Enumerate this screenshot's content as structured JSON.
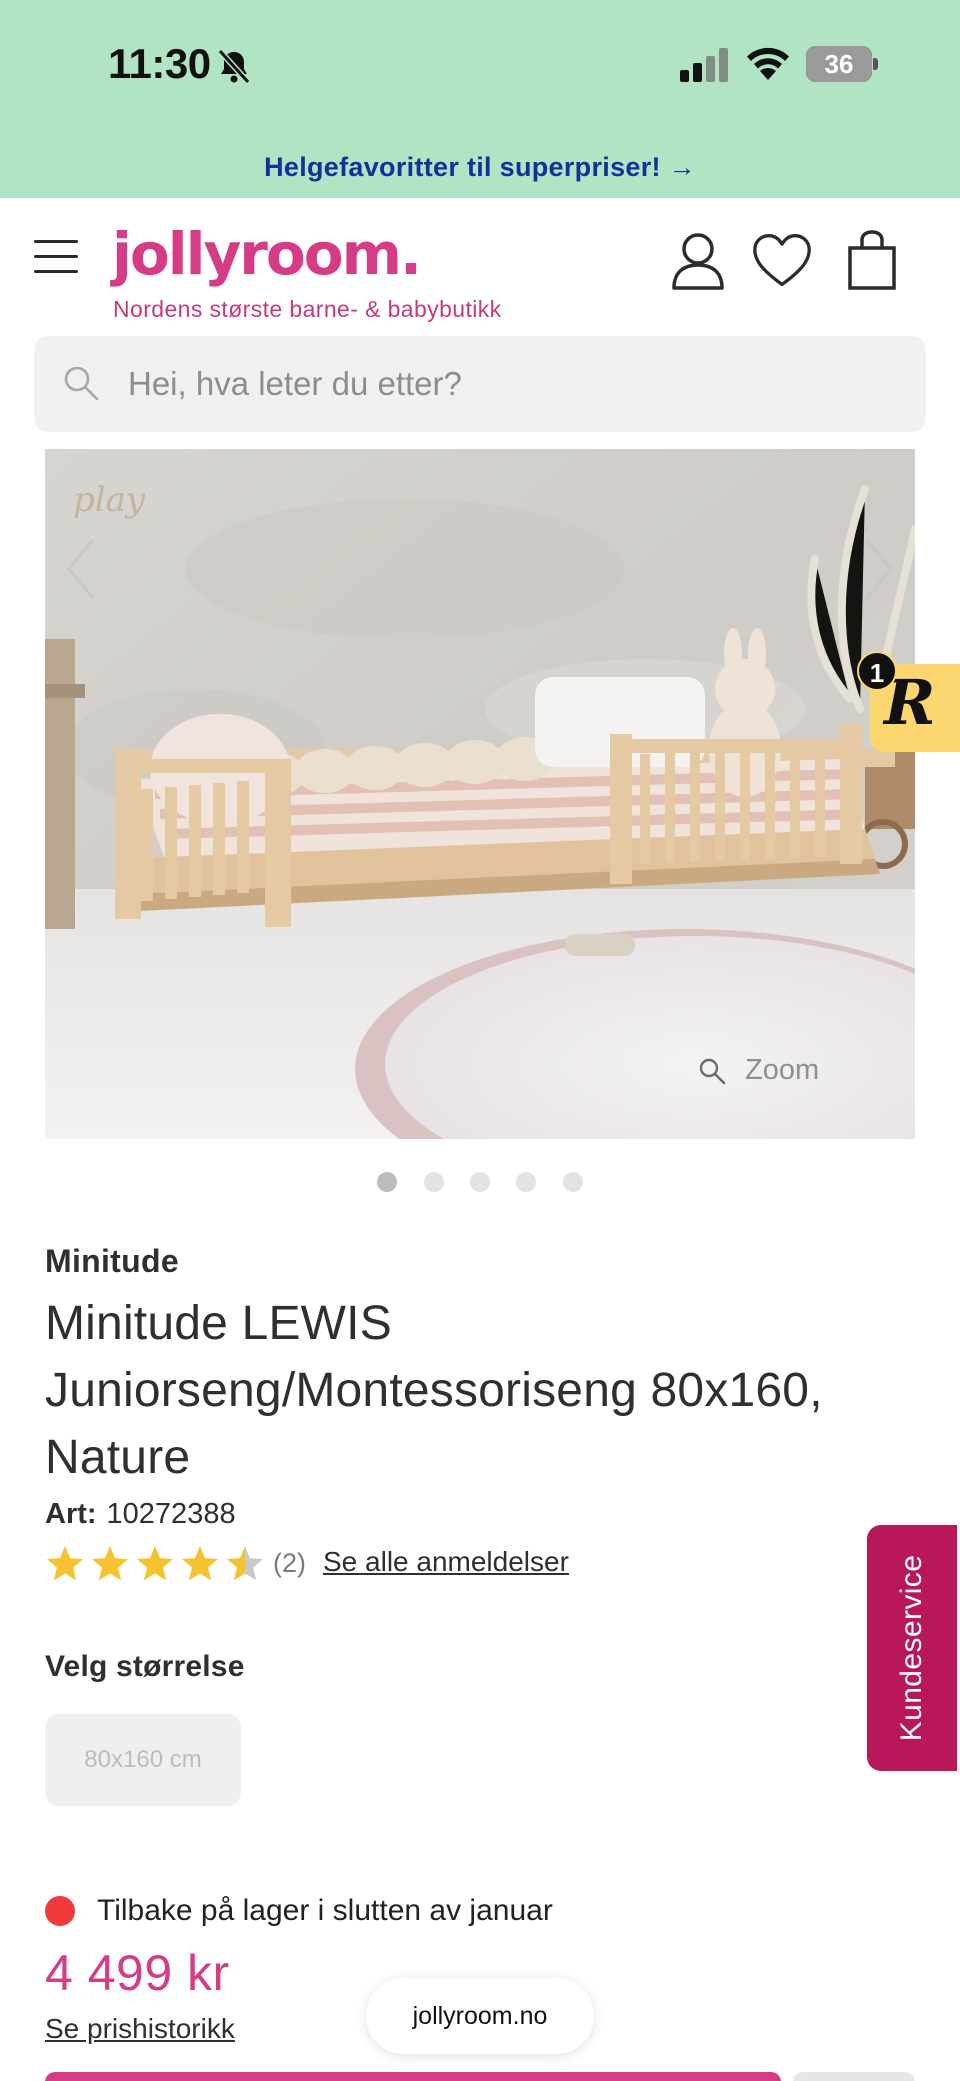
{
  "status_bar": {
    "time": "11:30",
    "battery": "36",
    "icons": [
      "bell-slash-icon",
      "signal-icon",
      "wifi-icon",
      "battery-icon"
    ]
  },
  "promo": {
    "text": "Helgefavoritter til superpriser! →",
    "color": "#12329b",
    "background": "#b0e4c2"
  },
  "header": {
    "logo": "jollyroom.",
    "tagline": "Nordens største barne- & babybutikk",
    "brand_color": "#d63b86",
    "icons": [
      "menu-icon",
      "account-icon",
      "heart-icon",
      "shopping-bag-icon"
    ]
  },
  "search": {
    "placeholder": "Hei, hva leter du etter?",
    "value": ""
  },
  "gallery": {
    "zoom_label": "Zoom",
    "slide_count": 5,
    "active_slide": 1,
    "watermark_text": "play"
  },
  "r_badge": {
    "letter": "R",
    "count": "1",
    "color": "#fcd66f"
  },
  "kundeservice": {
    "label": "Kundeservice",
    "color": "#b8175a"
  },
  "product": {
    "brand": "Minitude",
    "title": "Minitude LEWIS Juniorseng/Montessoriseng 80x160, Nature",
    "art_label": "Art:",
    "art_number": "10272388",
    "rating": {
      "value": 4.5,
      "max": 5,
      "count_text": "(2)",
      "link": "Se alle anmeldelser"
    },
    "size_label": "Velg størrelse",
    "sizes": [
      "80x160 cm"
    ],
    "stock_status": "Tilbake på lager i slutten av januar",
    "stock_color": "#ef3b3b",
    "price": "4 499 kr",
    "price_history_link": "Se prishistorikk"
  },
  "browser": {
    "domain": "jollyroom.no"
  }
}
